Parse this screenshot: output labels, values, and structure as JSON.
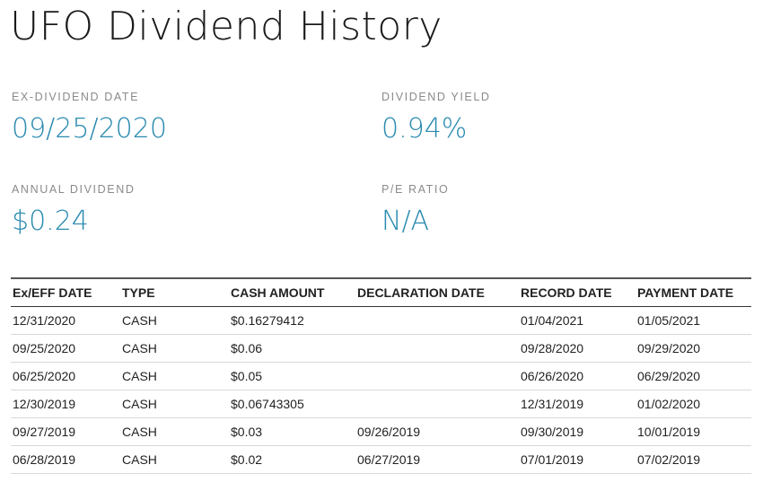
{
  "header": {
    "title": "UFO Dividend History"
  },
  "stats": {
    "ex_dividend_date": {
      "label": "EX-DIVIDEND DATE",
      "value": "09/25/2020"
    },
    "dividend_yield": {
      "label": "DIVIDEND YIELD",
      "value": "0.94%"
    },
    "annual_dividend": {
      "label": "ANNUAL DIVIDEND",
      "value": "$0.24"
    },
    "pe_ratio": {
      "label": "P/E RATIO",
      "value": "N/A"
    }
  },
  "table": {
    "columns": [
      "Ex/EFF DATE",
      "TYPE",
      "CASH AMOUNT",
      "DECLARATION DATE",
      "RECORD DATE",
      "PAYMENT DATE"
    ],
    "rows": [
      [
        "12/31/2020",
        "CASH",
        "$0.16279412",
        "",
        "01/04/2021",
        "01/05/2021"
      ],
      [
        "09/25/2020",
        "CASH",
        "$0.06",
        "",
        "09/28/2020",
        "09/29/2020"
      ],
      [
        "06/25/2020",
        "CASH",
        "$0.05",
        "",
        "06/26/2020",
        "06/29/2020"
      ],
      [
        "12/30/2019",
        "CASH",
        "$0.06743305",
        "",
        "12/31/2019",
        "01/02/2020"
      ],
      [
        "09/27/2019",
        "CASH",
        "$0.03",
        "09/26/2019",
        "09/30/2019",
        "10/01/2019"
      ],
      [
        "06/28/2019",
        "CASH",
        "$0.02",
        "06/27/2019",
        "07/01/2019",
        "07/02/2019"
      ]
    ]
  },
  "colors": {
    "accent": "#2a8ab0",
    "label": "#8a8a8a",
    "text": "#222222"
  }
}
